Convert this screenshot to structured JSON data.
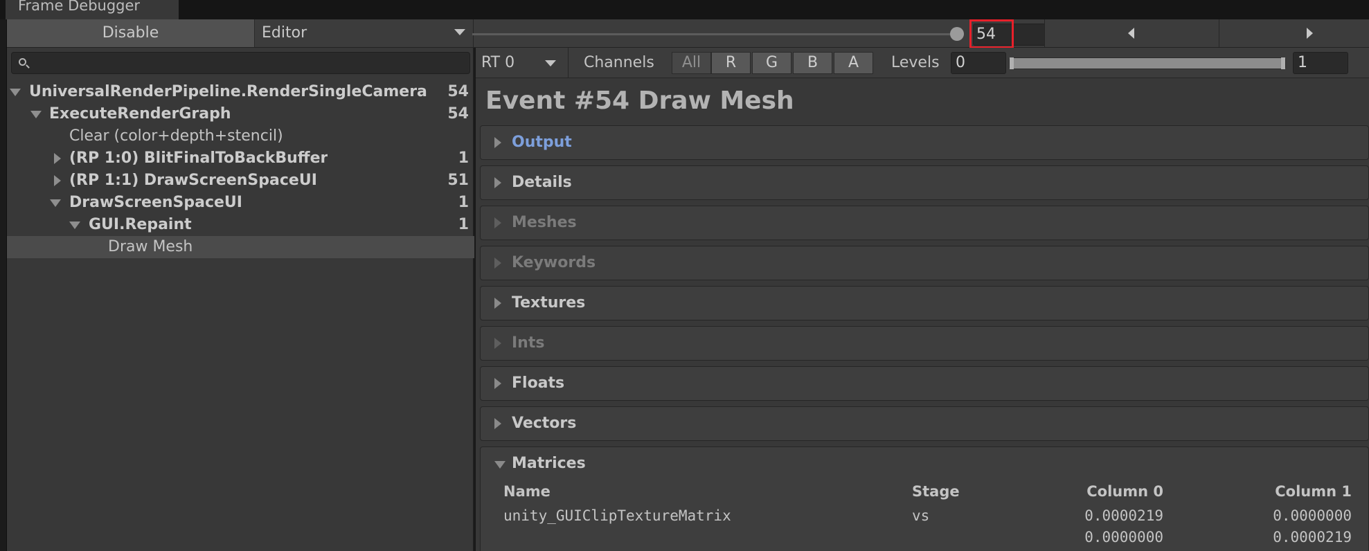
{
  "window": {
    "tab_title": "Frame Debugger"
  },
  "toolbar": {
    "disable_label": "Disable",
    "target_dropdown": "Editor",
    "event_value": "54",
    "prev_icon": "triangle-left-icon",
    "next_icon": "triangle-right-icon",
    "slider_fraction": 1.0
  },
  "search": {
    "placeholder": "",
    "icon": "search-icon"
  },
  "tree": {
    "items": [
      {
        "label": "UniversalRenderPipeline.RenderSingleCamera",
        "count": "54",
        "bold": true,
        "expanded": true
      },
      {
        "label": "ExecuteRenderGraph",
        "count": "54",
        "bold": true,
        "expanded": true
      },
      {
        "label": "Clear (color+depth+stencil)",
        "count": "",
        "bold": false,
        "expanded": null
      },
      {
        "label": "(RP 1:0) BlitFinalToBackBuffer",
        "count": "1",
        "bold": true,
        "expanded": false
      },
      {
        "label": "(RP 1:1) DrawScreenSpaceUI",
        "count": "51",
        "bold": true,
        "expanded": false
      },
      {
        "label": "DrawScreenSpaceUI",
        "count": "1",
        "bold": true,
        "expanded": true
      },
      {
        "label": "GUI.Repaint",
        "count": "1",
        "bold": true,
        "expanded": true
      },
      {
        "label": "Draw Mesh",
        "count": "",
        "bold": false,
        "expanded": null,
        "selected": true
      }
    ]
  },
  "rt_toolbar": {
    "rt_dropdown": "RT 0",
    "channels_label": "Channels",
    "channels": [
      "All",
      "R",
      "G",
      "B",
      "A"
    ],
    "levels_label": "Levels",
    "level_min": "0",
    "level_max": "1"
  },
  "event": {
    "title": "Event #54 Draw Mesh"
  },
  "sections": [
    {
      "label": "Output",
      "state": "link"
    },
    {
      "label": "Details",
      "state": "normal"
    },
    {
      "label": "Meshes",
      "state": "dim"
    },
    {
      "label": "Keywords",
      "state": "dim"
    },
    {
      "label": "Textures",
      "state": "normal"
    },
    {
      "label": "Ints",
      "state": "dim"
    },
    {
      "label": "Floats",
      "state": "normal"
    },
    {
      "label": "Vectors",
      "state": "normal"
    },
    {
      "label": "Matrices",
      "state": "open"
    }
  ],
  "matrices": {
    "headers": {
      "name": "Name",
      "stage": "Stage",
      "col0": "Column 0",
      "col1": "Column 1"
    },
    "rows": [
      {
        "name": "unity_GUIClipTextureMatrix",
        "stage": "vs",
        "col0": "0.0000219",
        "col1": "0.0000000"
      },
      {
        "name": "",
        "stage": "",
        "col0": "0.0000000",
        "col1": "0.0000219"
      }
    ]
  },
  "colors": {
    "highlight_box": "#e8202a",
    "link_blue": "#7d9fdb"
  }
}
